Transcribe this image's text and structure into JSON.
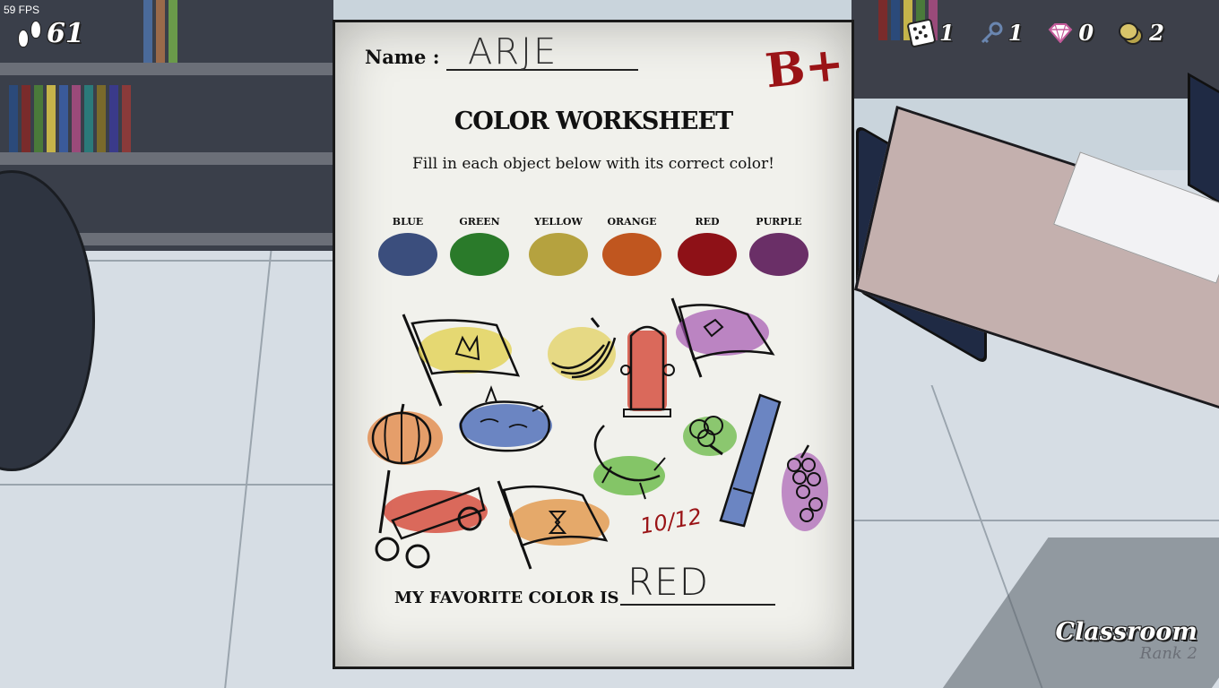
{
  "hud": {
    "fps": "59 FPS",
    "steps": "61",
    "dice": "1",
    "keys": "1",
    "gems": "0",
    "coins": "2"
  },
  "location": {
    "title": "Classroom",
    "rank": "Rank 2"
  },
  "worksheet": {
    "name_label": "Name :",
    "name_value": "ARJE",
    "grade": "B+",
    "title": "COLOR WORKSHEET",
    "instructions": "Fill in each object below with its correct color!",
    "swatches": [
      {
        "label": "BLUE",
        "color": "#3b4e7d"
      },
      {
        "label": "GREEN",
        "color": "#2a7a2a"
      },
      {
        "label": "YELLOW",
        "color": "#b5a23f"
      },
      {
        "label": "ORANGE",
        "color": "#c0561f"
      },
      {
        "label": "RED",
        "color": "#8e1117"
      },
      {
        "label": "PURPLE",
        "color": "#6a2f67"
      }
    ],
    "count": "10/12",
    "favorite_label": "MY FAVORITE COLOR IS",
    "favorite_value": "RED"
  },
  "drawings": [
    {
      "name": "yellow-flag",
      "fill": "#e0cf4a"
    },
    {
      "name": "bananas",
      "fill": "#e0c940"
    },
    {
      "name": "fire-hydrant",
      "fill": "#d23b2b"
    },
    {
      "name": "purple-flag",
      "fill": "#a455b0"
    },
    {
      "name": "pumpkin",
      "fill": "#e07a33"
    },
    {
      "name": "pond",
      "fill": "#4a6ab8"
    },
    {
      "name": "lizard",
      "fill": "#5fb53b"
    },
    {
      "name": "broccoli",
      "fill": "#5fb53b"
    },
    {
      "name": "blue-marker",
      "fill": "#4a6ab8"
    },
    {
      "name": "grapes",
      "fill": "#a455b0"
    },
    {
      "name": "red-wagon",
      "fill": "#d23b2b"
    },
    {
      "name": "orange-flag",
      "fill": "#e08a33"
    }
  ]
}
